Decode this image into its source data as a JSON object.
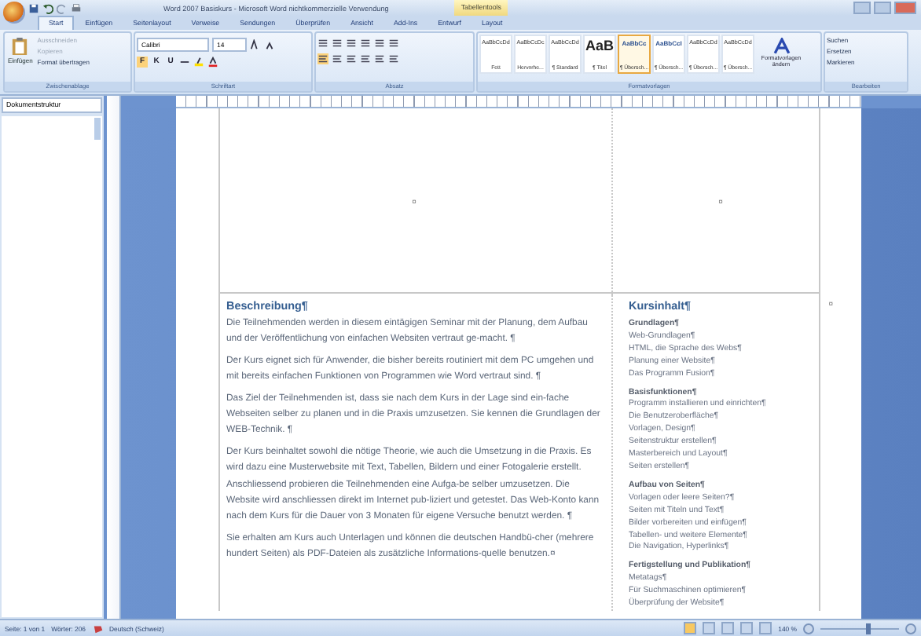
{
  "window": {
    "title": "Word 2007 Basiskurs - Microsoft Word nichtkommerzielle Verwendung",
    "contextual_tab": "Tabellentools"
  },
  "tabs": [
    {
      "label": "Start",
      "selected": true
    },
    {
      "label": "Einfügen",
      "selected": false
    },
    {
      "label": "Seitenlayout",
      "selected": false
    },
    {
      "label": "Verweise",
      "selected": false
    },
    {
      "label": "Sendungen",
      "selected": false
    },
    {
      "label": "Überprüfen",
      "selected": false
    },
    {
      "label": "Ansicht",
      "selected": false
    },
    {
      "label": "Add-Ins",
      "selected": false
    },
    {
      "label": "Entwurf",
      "selected": false
    },
    {
      "label": "Layout",
      "selected": false
    }
  ],
  "ribbon": {
    "groups": [
      {
        "kind": "clipboard",
        "label": "Zwischenablage",
        "paste": "Einfügen",
        "items": [
          "Ausschneiden",
          "Kopieren",
          "Format übertragen"
        ]
      },
      {
        "kind": "font",
        "label": "Schriftart",
        "font": "Calibri",
        "size": "14",
        "buttons": [
          "F",
          "K",
          "U"
        ]
      },
      {
        "kind": "paragraph",
        "label": "Absatz"
      },
      {
        "kind": "styles",
        "label": "Formatvorlagen",
        "change": "Formatvorlagen ändern",
        "styles": [
          {
            "sample": "AaBbCcDd",
            "name": "Fett",
            "selected": false
          },
          {
            "sample": "AaBbCcDc",
            "name": "Hervorhe...",
            "selected": false
          },
          {
            "sample": "AaBbCcDd",
            "name": "¶ Standard",
            "selected": false
          },
          {
            "sample": "AaB",
            "name": "¶ Titel",
            "selected": false
          },
          {
            "sample": "AaBbCc",
            "name": "¶ Übersch...",
            "selected": true
          },
          {
            "sample": "AaBbCcI",
            "name": "¶ Übersch...",
            "selected": false
          },
          {
            "sample": "AaBbCcDd",
            "name": "¶ Übersch...",
            "selected": false
          },
          {
            "sample": "AaBbCcDd",
            "name": "¶ Übersch...",
            "selected": false
          }
        ]
      },
      {
        "kind": "editing",
        "label": "Bearbeiten",
        "items": [
          "Suchen",
          "Ersetzen",
          "Markieren"
        ]
      }
    ]
  },
  "nav_pane": {
    "title": "Dokumentstruktur"
  },
  "document": {
    "cell_marks": [
      "¤",
      "¤"
    ],
    "row_mark": "¤",
    "left": {
      "heading": "Beschreibung¶",
      "paragraphs": [
        "Die Teilnehmenden werden in diesem eintägigen Seminar mit der Planung, dem Aufbau und der Veröffentlichung von einfachen Websiten vertraut ge-macht. ¶",
        "Der Kurs eignet sich für Anwender, die bisher bereits routiniert mit dem PC umgehen und mit bereits einfachen Funktionen von Programmen wie Word vertraut sind. ¶",
        "Das Ziel der Teilnehmenden ist, dass sie nach dem Kurs in der Lage sind ein-fache Webseiten selber zu planen und in die Praxis umzusetzen. Sie kennen die Grundlagen der WEB-Technik. ¶",
        "Der Kurs beinhaltet sowohl die nötige Theorie, wie auch die Umsetzung in die Praxis. Es wird dazu eine Musterwebsite mit Text, Tabellen, Bildern und einer Fotogalerie erstellt. Anschliessend probieren die Teilnehmenden eine Aufga-be selber umzusetzen. Die Website wird anschliessen direkt im Internet pub-liziert und getestet. Das Web-Konto kann nach dem Kurs für die Dauer von 3 Monaten für eigene Versuche benutzt werden. ¶",
        "Sie erhalten am Kurs auch Unterlagen und können die deutschen Handbü-cher (mehrere hundert Seiten) als PDF-Dateien als zusätzliche Informations-quelle benutzen.¤"
      ]
    },
    "right": {
      "heading": "Kursinhalt¶",
      "sections": [
        {
          "title": "Grundlagen¶",
          "items": [
            "Web-Grundlagen¶",
            "HTML, die Sprache des Webs¶",
            "Planung einer Website¶",
            "Das Programm Fusion¶"
          ]
        },
        {
          "title": "Basisfunktionen¶",
          "items": [
            "Programm installieren und einrichten¶",
            "Die Benutzeroberfläche¶",
            "Vorlagen, Design¶",
            "Seitenstruktur erstellen¶",
            "Masterbereich und Layout¶",
            "Seiten erstellen¶"
          ]
        },
        {
          "title": "Aufbau von Seiten¶",
          "items": [
            "Vorlagen oder leere Seiten?¶",
            "Seiten mit Titeln und Text¶",
            "Bilder vorbereiten und einfügen¶",
            "Tabellen- und weitere Elemente¶",
            "Die Navigation, Hyperlinks¶"
          ]
        },
        {
          "title": "Fertigstellung und Publikation¶",
          "items": [
            "Metatags¶",
            "Für Suchmaschinen optimieren¶",
            "Überprüfung der Website¶"
          ]
        }
      ]
    }
  },
  "status_bar": {
    "page": "Seite: 1 von 1",
    "words": "Wörter: 206",
    "language": "Deutsch (Schweiz)",
    "zoom": "140 %",
    "zoom_slider": {
      "level": 0.6
    }
  }
}
